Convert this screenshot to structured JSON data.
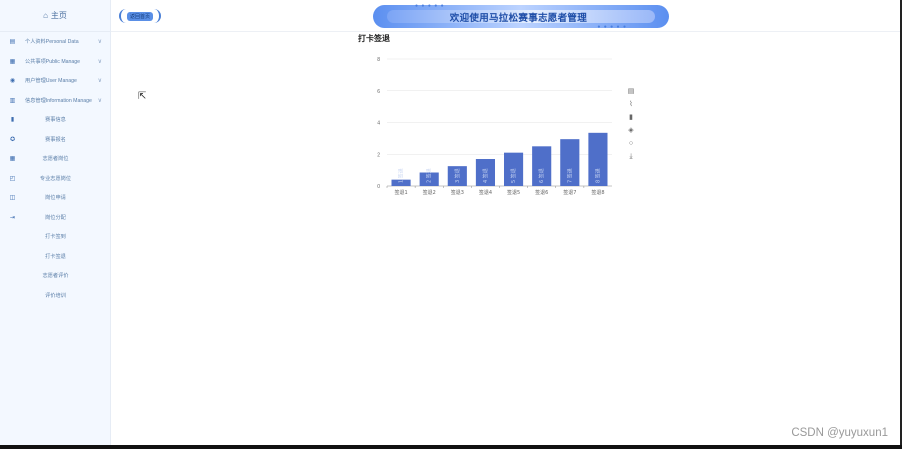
{
  "sidebar": {
    "home": "主页",
    "items": [
      {
        "label": "个人资料Personal Data",
        "icon": "document-icon",
        "chev": "∨"
      },
      {
        "label": "公共事项Public Manage",
        "icon": "clipboard-icon",
        "chev": "∨"
      },
      {
        "label": "用户管理User Manage",
        "icon": "users-icon",
        "chev": "∨"
      },
      {
        "label": "信息管理Information Manage",
        "icon": "chart-icon",
        "chev": "∨"
      }
    ],
    "subitems": [
      {
        "label": "赛事信息",
        "icon": "bookmark-icon"
      },
      {
        "label": "赛事报名",
        "icon": "user-badge-icon"
      },
      {
        "label": "志愿者岗位",
        "icon": "calendar-icon"
      },
      {
        "label": "专业志愿岗位",
        "icon": "calendar-gear-icon"
      },
      {
        "label": "岗位申请",
        "icon": "book-icon"
      },
      {
        "label": "岗位分配",
        "icon": "logout-icon"
      },
      {
        "label": "打卡签到",
        "icon": ""
      },
      {
        "label": "打卡签退",
        "icon": ""
      },
      {
        "label": "志愿者评价",
        "icon": ""
      },
      {
        "label": "评价培训",
        "icon": ""
      }
    ]
  },
  "topbar": {
    "back": "返回首页",
    "banner_title": "欢迎使用马拉松赛事志愿者管理",
    "dots": "● ● ● ● ●"
  },
  "chart_data": {
    "type": "bar",
    "title": "打卡签退",
    "categories": [
      "签退1",
      "签退2",
      "签退3",
      "签退4",
      "签退5",
      "签退6",
      "签退7",
      "签退8"
    ],
    "values": [
      0.4,
      0.85,
      1.25,
      1.7,
      2.1,
      2.5,
      2.95,
      3.35
    ],
    "bar_labels": [
      "1 签退",
      "2 签退",
      "3 签退",
      "4 签退",
      "5 签退",
      "6 签退",
      "7 签退",
      "8 签退"
    ],
    "ylim": [
      0,
      8
    ],
    "yticks": [
      0,
      2,
      4,
      6,
      8
    ],
    "grid": true,
    "bar_color": "#4f6fc9"
  },
  "toolbox": {
    "icons": [
      {
        "name": "data-view-icon",
        "glyph": "▤"
      },
      {
        "name": "line-chart-icon",
        "glyph": "⌇"
      },
      {
        "name": "bar-chart-icon",
        "glyph": "▮"
      },
      {
        "name": "stack-icon",
        "glyph": "◈"
      },
      {
        "name": "restore-icon",
        "glyph": "○"
      },
      {
        "name": "download-icon",
        "glyph": "⤓"
      }
    ]
  },
  "watermark": "CSDN @yuyuxun1"
}
